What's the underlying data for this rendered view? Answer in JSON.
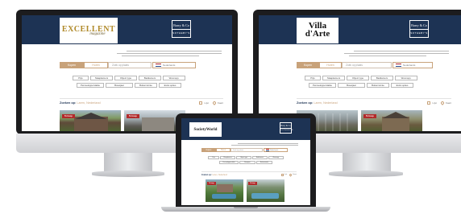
{
  "left_monitor": {
    "logo": {
      "title": "EXCELLENT",
      "subtitle": "magazine"
    },
    "brand": {
      "line1": "Barry & Co",
      "line2": "SOTHEBY'S"
    },
    "search": {
      "tab_active": "Kopen",
      "tab_inactive": "Huren",
      "placeholder": "Zoek op plaats",
      "language": "Nederlands"
    },
    "filters": [
      "Prijs",
      "Slaapkamers",
      "Object type",
      "Badkamers",
      "Woonopp.",
      "Perceeloppervlakte",
      "Bouwjaar",
      "Buitenruimte",
      "Extra opties"
    ],
    "results": {
      "label": "Zoeken op:",
      "location": "Laren, Nederland",
      "view_list": "Lijst",
      "view_map": "Kaart"
    },
    "cards": [
      {
        "badge": "Te koop"
      },
      {
        "badge": "Te koop"
      }
    ]
  },
  "right_monitor": {
    "logo": {
      "title_line1": "Villa",
      "title_line2": "d'Arte"
    },
    "brand": {
      "line1": "Barry & Co",
      "line2": "SOTHEBY'S"
    },
    "search": {
      "tab_active": "Kopen",
      "tab_inactive": "Huren",
      "placeholder": "Zoek op plaats",
      "language": "Nederlands"
    },
    "filters": [
      "Prijs",
      "Slaapkamers",
      "Object type",
      "Badkamers",
      "Woonopp.",
      "Perceeloppervlakte",
      "Bouwjaar",
      "Buitenruimte",
      "Extra opties"
    ],
    "results": {
      "label": "Zoeken op:",
      "location": "Laren, Nederland",
      "view_list": "Lijst",
      "view_map": "Kaart"
    },
    "cards": [
      {
        "badge": "Te koop"
      },
      {
        "badge": "Te koop"
      }
    ]
  },
  "laptop": {
    "logo": {
      "title": "SocietyWorld"
    },
    "brand": {
      "line1": "Barry & Co",
      "line2": "SOTHEBY'S"
    },
    "search": {
      "tab_active": "Kopen",
      "tab_inactive": "Huren",
      "placeholder": "Zoek op plaats",
      "language": "Nederlands"
    },
    "filters": [
      "Prijs",
      "Slaapkamers",
      "Object type",
      "Badkamers",
      "Woonopp.",
      "Perceeloppervlakte",
      "Bouwjaar",
      "Buitenruimte"
    ],
    "results": {
      "label": "Zoeken op:",
      "location": "Laren, Nederland",
      "view_list": "Lijst",
      "view_map": "Kaart"
    },
    "cards": [
      {
        "badge": "Te koop"
      },
      {
        "badge": "Te koop"
      }
    ]
  },
  "colors": {
    "header_navy": "#1d3354",
    "accent_tan": "#c8a27a",
    "badge_red": "#b22a2a"
  }
}
